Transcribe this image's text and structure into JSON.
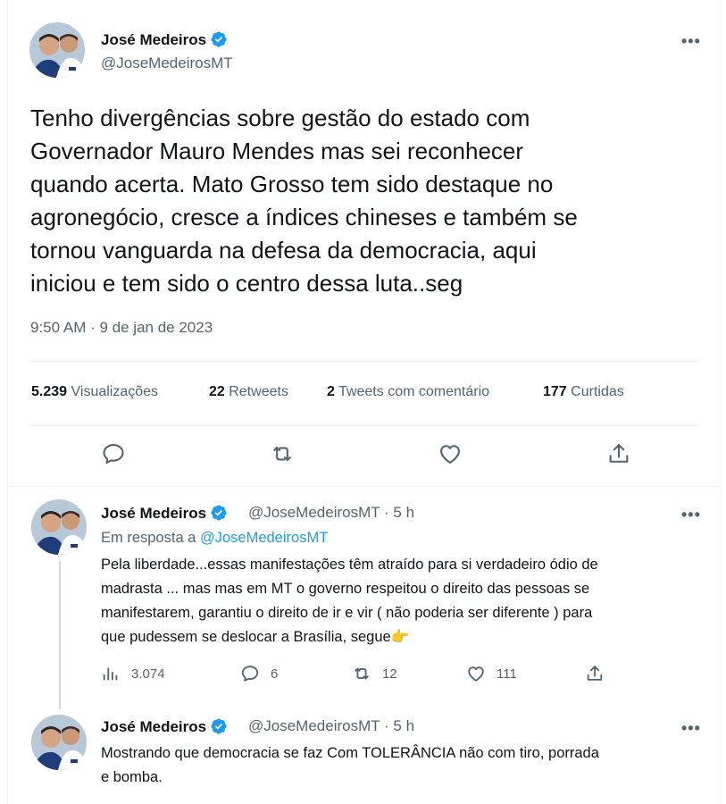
{
  "main_tweet": {
    "author_name": "José Medeiros",
    "handle": "@JoseMedeirosMT",
    "more_label": "•••",
    "text_lines": [
      "Tenho divergências sobre gestão do estado com",
      "Governador Mauro Mendes mas  sei reconhecer",
      "quando acerta. Mato Grosso tem sido destaque no",
      "agronegócio, cresce a índices chineses e também se",
      "tornou vanguarda na defesa da democracia, aqui",
      "iniciou e tem sido o centro dessa luta..seg"
    ],
    "timestamp": "9:50 AM · 9 de jan de 2023",
    "stats": {
      "views_count": "5.239",
      "views_label": "Visualizações",
      "retweets_count": "22",
      "retweets_label": "Retweets",
      "quotes_count": "2",
      "quotes_label": "Tweets com comentário",
      "likes_count": "177",
      "likes_label": "Curtidas"
    },
    "actions": [
      "reply-icon",
      "retweet-icon",
      "like-icon",
      "share-icon"
    ]
  },
  "reply_1": {
    "author_name": "José Medeiros",
    "handle_time": "@JoseMedeirosMT · 5 h",
    "more_label": "•••",
    "reply_prefix": "Em resposta a",
    "reply_handle": "@JoseMedeirosMT",
    "text_lines": [
      "Pela liberdade...essas manifestações têm atraído para si verdadeiro ódio de",
      "madrasta ... mas mas em MT o governo respeitou o direito das pessoas se",
      "manifestarem, garantiu o direito de ir e vir ( não poderia ser diferente ) para",
      "que pudessem se deslocar a Brasília, segue👉"
    ],
    "metrics": {
      "views": "3.074",
      "replies": "6",
      "retweets": "12",
      "likes": "111"
    }
  },
  "reply_2": {
    "author_name": "José Medeiros",
    "handle_time": "@JoseMedeirosMT · 5 h",
    "more_label": "•••",
    "text_lines": [
      "Mostrando que democracia se faz Com TOLERÂNCIA não com tiro, porrada",
      "e bomba."
    ]
  },
  "colors": {
    "accent": "#1d9bf0",
    "muted": "#536471",
    "text": "#0f1419",
    "divider": "#eff3f4"
  }
}
